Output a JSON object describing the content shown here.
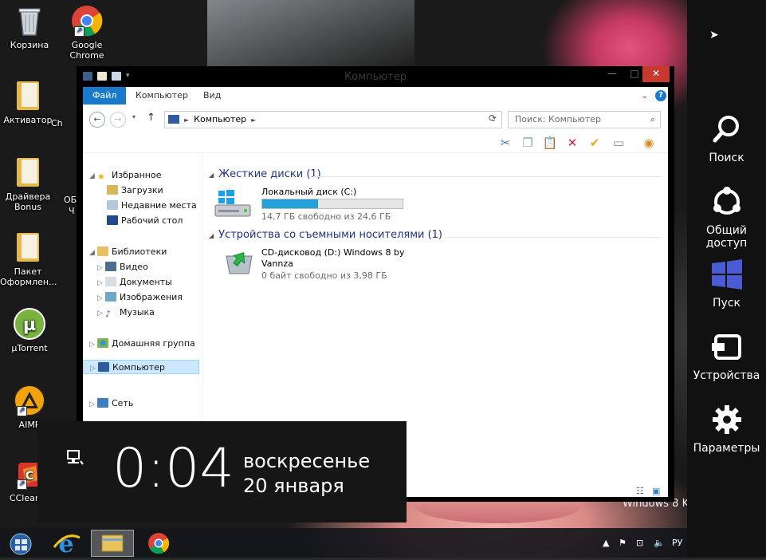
{
  "desktop": {
    "icons": [
      {
        "label": "Корзина"
      },
      {
        "label": "Google Chrome"
      },
      {
        "label": "Активатор"
      },
      {
        "label": "Драйвера Bonus"
      },
      {
        "label": "Пакет Оформлен..."
      },
      {
        "label": "µTorrent"
      },
      {
        "label": "AIMP"
      },
      {
        "label": "CCleaner"
      }
    ],
    "partial_labels": [
      "Ch",
      "ОБ",
      "Ч"
    ],
    "watermark": "Windows 8 K"
  },
  "explorer": {
    "title": "Компьютер",
    "ribbon_tabs": [
      "Файл",
      "Компьютер",
      "Вид"
    ],
    "window_buttons": {
      "minimize": "—",
      "maximize": "□",
      "close": "✕"
    },
    "address": "Компьютер",
    "search_placeholder": "Поиск: Компьютер",
    "nav": {
      "favorites": "Избранное",
      "favorites_items": [
        "Загрузки",
        "Недавние места",
        "Рабочий стол"
      ],
      "libraries": "Библиотеки",
      "libraries_items": [
        "Видео",
        "Документы",
        "Изображения",
        "Музыка"
      ],
      "homegroup": "Домашняя группа",
      "computer": "Компьютер",
      "network": "Сеть"
    },
    "groups": {
      "hdd": "Жесткие диски (1)",
      "removable": "Устройства со съемными носителями (1)"
    },
    "drives": {
      "c_name": "Локальный диск (C:)",
      "c_free": "14,7 ГБ свободно из 24,6 ГБ",
      "c_used_fraction": 0.4,
      "d_name_line1": "CD-дисковод (D:) Windows 8 by",
      "d_name_line2": "Vannza",
      "d_free": "0 байт свободно из 3,98 ГБ"
    }
  },
  "charms": [
    {
      "label": "Поиск",
      "icon": "search-icon"
    },
    {
      "label": "Общий доступ",
      "icon": "share-icon"
    },
    {
      "label": "Пуск",
      "icon": "windows-start-icon"
    },
    {
      "label": "Устройства",
      "icon": "devices-icon"
    },
    {
      "label": "Параметры",
      "icon": "settings-icon"
    }
  ],
  "clock": {
    "time": "0:04",
    "day": "воскресенье",
    "date": "20 января"
  },
  "taskbar": {
    "language": "РУ"
  },
  "colors": {
    "accent": "#1979ca",
    "progress": "#26a0da",
    "charms_bg": "#111111",
    "close_red": "#c7392c"
  }
}
